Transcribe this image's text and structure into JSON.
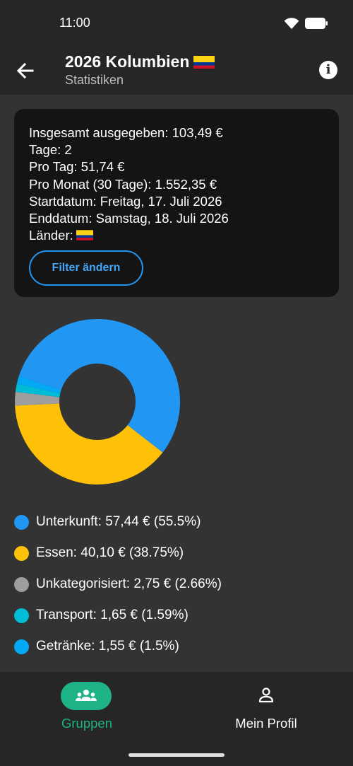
{
  "status_bar": {
    "time": "11:00"
  },
  "header": {
    "title": "2026 Kolumbien",
    "subtitle": "Statistiken",
    "flag_colors": [
      "#FCD116",
      "#003893",
      "#CE1126"
    ]
  },
  "summary": {
    "total": "Insgesamt ausgegeben: 103,49 €",
    "days": "Tage: 2",
    "per_day": "Pro Tag: 51,74 €",
    "per_month": "Pro Monat (30 Tage): 1.552,35 €",
    "start_date": "Startdatum: Freitag, 17. Juli 2026",
    "end_date": "Enddatum: Samstag, 18. Juli 2026",
    "countries_label": "Länder:",
    "filter_button": "Filter ändern"
  },
  "chart_data": {
    "type": "pie",
    "donut": true,
    "series": [
      {
        "name": "Unterkunft",
        "value": 57.44,
        "percent": 55.5,
        "color": "#2196F3"
      },
      {
        "name": "Essen",
        "value": 40.1,
        "percent": 38.75,
        "color": "#FFC107"
      },
      {
        "name": "Unkategorisiert",
        "value": 2.75,
        "percent": 2.66,
        "color": "#9E9E9E"
      },
      {
        "name": "Transport",
        "value": 1.65,
        "percent": 1.59,
        "color": "#00BCD4"
      },
      {
        "name": "Getränke",
        "value": 1.55,
        "percent": 1.5,
        "color": "#03A9F4"
      }
    ]
  },
  "legend": [
    {
      "text": "Unterkunft: 57,44 € (55.5%)",
      "color": "#2196F3"
    },
    {
      "text": "Essen: 40,10 € (38.75%)",
      "color": "#FFC107"
    },
    {
      "text": "Unkategorisiert: 2,75 € (2.66%)",
      "color": "#9E9E9E"
    },
    {
      "text": "Transport: 1,65 € (1.59%)",
      "color": "#00BCD4"
    },
    {
      "text": "Getränke: 1,55 € (1.5%)",
      "color": "#03A9F4"
    }
  ],
  "bottom_nav": {
    "groups_label": "Gruppen",
    "profile_label": "Mein Profil",
    "active_color": "#1DB386"
  },
  "icons": {
    "back": "arrow-left-icon",
    "info": "info-icon",
    "groups": "groups-icon",
    "profile": "person-icon"
  }
}
